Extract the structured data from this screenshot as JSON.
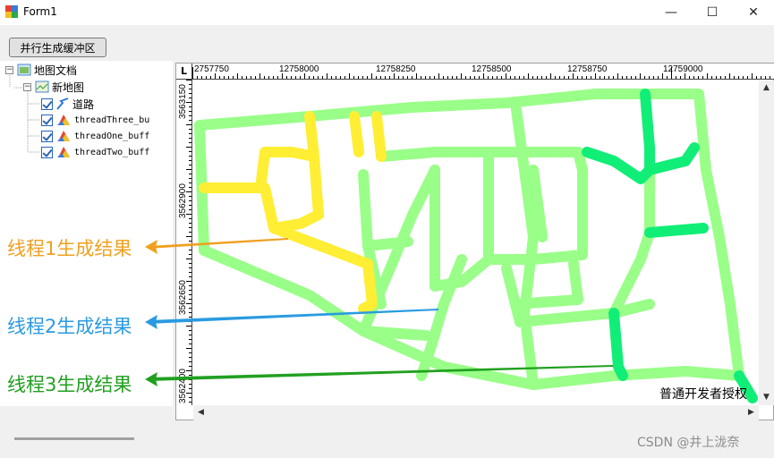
{
  "window": {
    "title": "Form1",
    "minimize_glyph": "—",
    "maximize_glyph": "☐",
    "close_glyph": "✕"
  },
  "toolbar": {
    "generate_button_label": "并行生成缓冲区"
  },
  "toc": {
    "root_label": "地图文档",
    "map_label": "新地图",
    "layers": [
      {
        "label": "道路",
        "icon": "polyline-layer-icon",
        "checked": true
      },
      {
        "label": "threadThree_bu",
        "icon": "polygon-layer-icon",
        "checked": true
      },
      {
        "label": "threadOne_buff",
        "icon": "polygon-layer-icon",
        "checked": true
      },
      {
        "label": "threadTwo_buff",
        "icon": "polygon-layer-icon",
        "checked": true
      }
    ]
  },
  "rulers": {
    "corner": "L",
    "x_ticks": [
      "2757750",
      "12758000",
      "12758250",
      "12758500",
      "12758750",
      "12759000"
    ],
    "y_ticks": [
      "3563150",
      "3562900",
      "3562650",
      "3562400"
    ]
  },
  "map": {
    "license_text": "普通开发者授权",
    "colors": {
      "thread1": "#ffee33",
      "thread2": "#99ff88",
      "thread3": "#11ee77"
    }
  },
  "annotations": {
    "thread1": "线程1生成结果",
    "thread2": "线程2生成结果",
    "thread3": "线程3生成结果",
    "colors": {
      "thread1": "#f0a020",
      "thread2": "#2a9be0",
      "thread3": "#21a020"
    }
  },
  "watermark": "CSDN @井上泷奈"
}
